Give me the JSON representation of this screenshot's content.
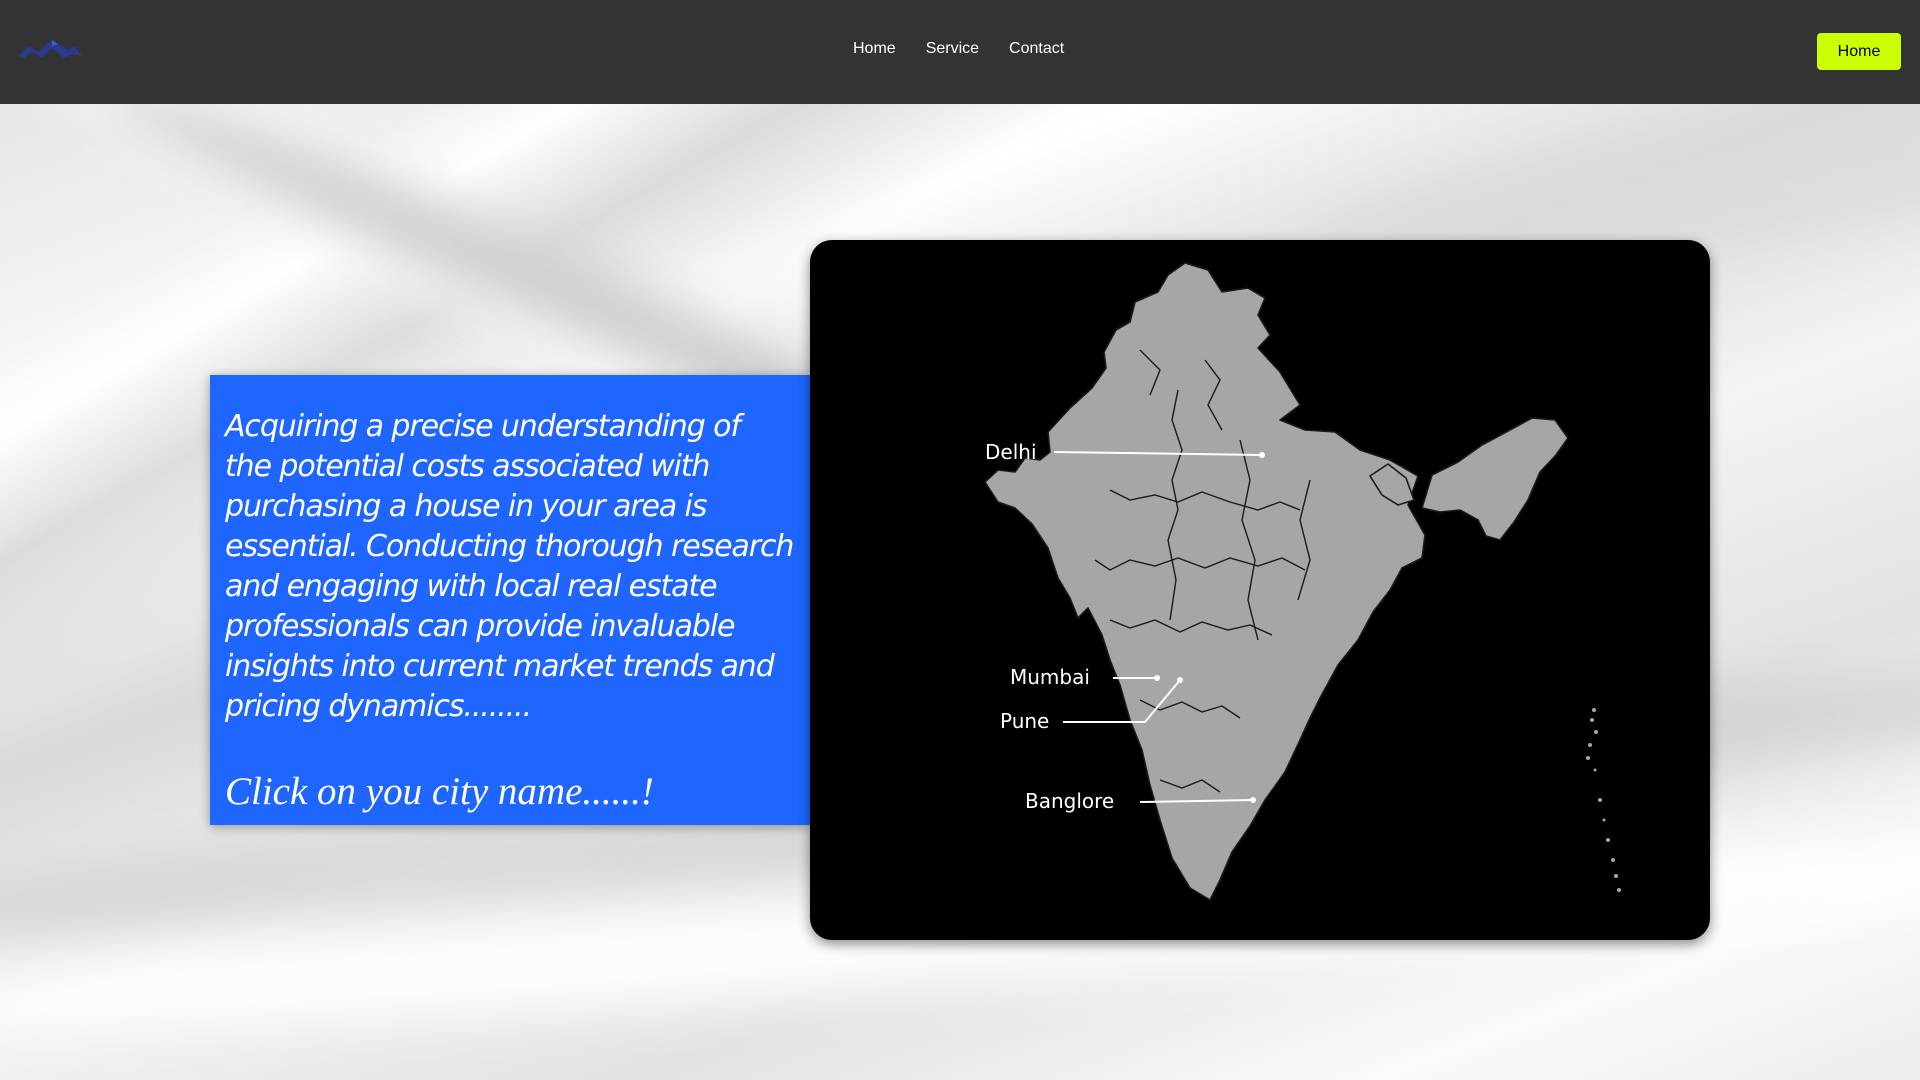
{
  "nav": {
    "links": [
      "Home",
      "Service",
      "Contact"
    ],
    "button_label": "Home"
  },
  "intro": {
    "body": "Acquiring a precise understanding of the potential costs associated with purchasing a house in your area is essential. Conducting thorough research and engaging with local real estate professionals can provide invaluable insights into current market trends and pricing dynamics........",
    "cta": "Click on you city name......!"
  },
  "map": {
    "cities": [
      "Delhi",
      "Mumbai",
      "Pune",
      "Banglore"
    ]
  },
  "colors": {
    "navbar": "#333333",
    "nav_button": "#ccff00",
    "card": "#1e66ff",
    "map_bg": "#000000",
    "map_land": "#a6a6a8"
  },
  "icons": {
    "logo": "house-roof-logo-icon"
  }
}
